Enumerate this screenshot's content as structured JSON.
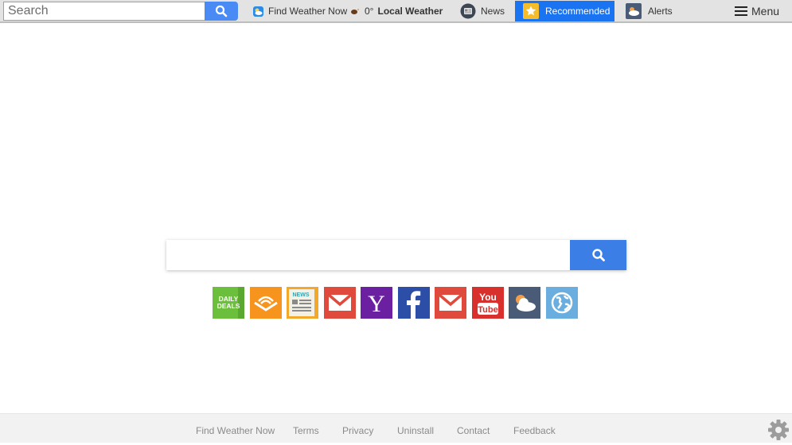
{
  "topbar": {
    "search_placeholder": "Search",
    "nav": {
      "find_weather": "Find Weather Now",
      "local_temp": "0°",
      "local_label": "Local Weather",
      "news": "News",
      "recommended": "Recommended",
      "alerts": "Alerts",
      "menu": "Menu"
    }
  },
  "main": {
    "search_placeholder": "",
    "tiles": [
      {
        "name": "daily-deals",
        "label": "DAILY DEALS",
        "color": "#6cbf3c"
      },
      {
        "name": "audible",
        "label": "Audible",
        "color": "#f7941d"
      },
      {
        "name": "news",
        "label": "NEWS",
        "color": "#f2a82a"
      },
      {
        "name": "gmail",
        "label": "Gmail",
        "color": "#e04a3c"
      },
      {
        "name": "yahoo",
        "label": "Y",
        "color": "#6b1fa1"
      },
      {
        "name": "facebook",
        "label": "f",
        "color": "#2d4ea6"
      },
      {
        "name": "mail",
        "label": "Mail",
        "color": "#e04a3c"
      },
      {
        "name": "youtube",
        "label": "YouTube",
        "color": "#d8302c"
      },
      {
        "name": "weather",
        "label": "Weather",
        "color": "#4a5b78"
      },
      {
        "name": "web",
        "label": "Web",
        "color": "#6aaee0"
      }
    ]
  },
  "footer": {
    "links": [
      "Find Weather Now",
      "Terms",
      "Privacy",
      "Uninstall",
      "Contact",
      "Feedback"
    ]
  },
  "colors": {
    "accent": "#1a73f0",
    "search_button": "#3a7ee6"
  }
}
